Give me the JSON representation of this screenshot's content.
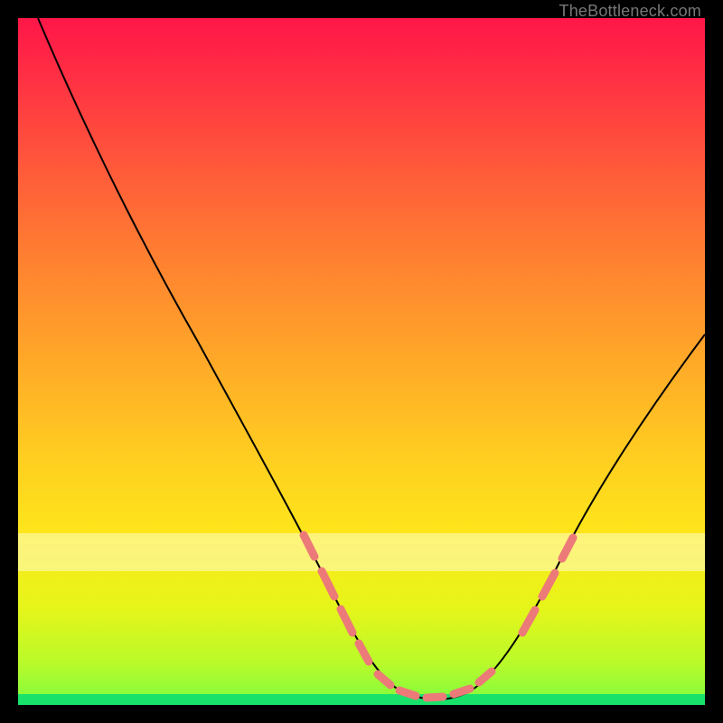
{
  "watermark": "TheBottleneck.com",
  "chart_data": {
    "type": "line",
    "title": "",
    "xlabel": "",
    "ylabel": "",
    "xlim": [
      0,
      100
    ],
    "ylim": [
      0,
      100
    ],
    "grid": false,
    "legend": false,
    "series": [
      {
        "name": "curve",
        "x": [
          3,
          10,
          20,
          30,
          38,
          44,
          50,
          55,
          58,
          62,
          66,
          72,
          80,
          90,
          99
        ],
        "y": [
          100,
          86,
          68,
          50,
          34,
          22,
          10,
          4,
          1.5,
          1.5,
          4,
          12,
          26,
          42,
          55
        ]
      }
    ],
    "highlight_ranges": [
      {
        "name": "left-descent-dash",
        "x_from": 40,
        "x_to": 48
      },
      {
        "name": "valley-dash",
        "x_from": 52,
        "x_to": 67
      },
      {
        "name": "right-ascent-dash",
        "x_from": 72,
        "x_to": 80
      }
    ],
    "gradient_stops": [
      {
        "pos": 0.0,
        "color": "#ff1648"
      },
      {
        "pos": 0.5,
        "color": "#ffa928"
      },
      {
        "pos": 0.76,
        "color": "#fde81a"
      },
      {
        "pos": 1.0,
        "color": "#7cfc3f"
      }
    ],
    "pale_band_y": [
      20,
      26
    ],
    "green_base_y": [
      0,
      1.6
    ]
  }
}
